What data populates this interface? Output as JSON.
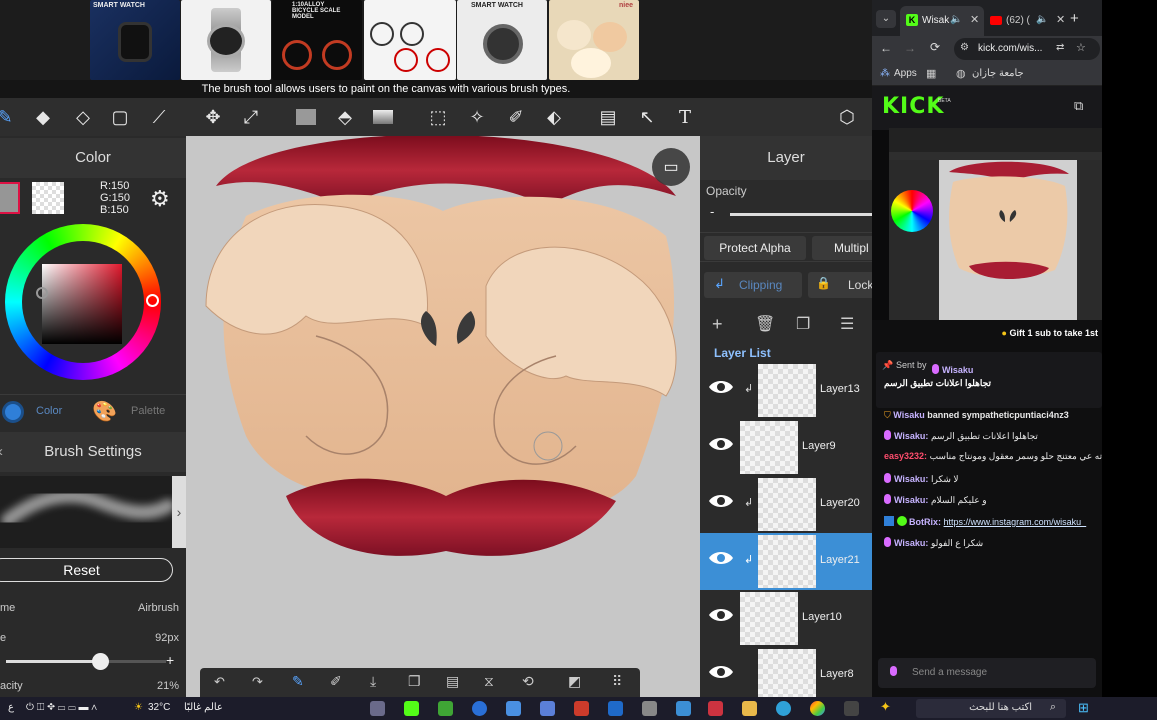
{
  "app": {
    "tooltip": "The brush tool allows users to paint on the canvas with various brush types.",
    "ads": [
      {
        "label": "SMART WATCH"
      },
      {
        "label": ""
      },
      {
        "label": "1:10ALLOY BICYCLE SCALE MODEL"
      },
      {
        "label": ""
      },
      {
        "label": "SMART WATCH"
      },
      {
        "label": "niee"
      }
    ],
    "toolbar_text_tool": "T",
    "color_panel": {
      "title": "Color",
      "r": "R:150",
      "g": "G:150",
      "b": "B:150",
      "tab_color": "Color",
      "tab_palette": "Palette"
    },
    "brush_panel": {
      "title": "Brush Settings",
      "reset_label": "Reset",
      "name_label": "me",
      "name_value": "Airbrush",
      "size_label": "e",
      "size_value": "92px",
      "size_slider_fraction": 0.59,
      "opacity_label": "acity",
      "opacity_value": "21%",
      "plus": "+",
      "minus": "-"
    },
    "layer_panel": {
      "title": "Layer",
      "opacity_label": "Opacity",
      "minus": "-",
      "protect_alpha": "Protect Alpha",
      "multiply": "Multipl",
      "clipping": "Clipping",
      "lock": "Lock",
      "list_title": "Layer List",
      "layers": [
        {
          "name": "Layer13",
          "selected": false
        },
        {
          "name": "Layer9",
          "selected": false
        },
        {
          "name": "Layer20",
          "selected": false
        },
        {
          "name": "Layer21",
          "selected": true
        },
        {
          "name": "Layer10",
          "selected": false
        },
        {
          "name": "Layer8",
          "selected": false
        }
      ]
    }
  },
  "browser": {
    "tabs": [
      {
        "label": "Wisak"
      },
      {
        "label": "(62) ("
      }
    ],
    "address": "kick.com/wis...",
    "bookmarks": {
      "apps": "Apps",
      "folder": "جامعة جازان"
    },
    "kick_logo": "KICK",
    "kick_beta": "BETA",
    "gift_banner": "Gift 1 sub to take 1st",
    "pinned": {
      "sent_by_label": "Sent by",
      "user": "Wisaku",
      "text": "تجاهلوا اعلانات تطبيق الرسم"
    },
    "chat": [
      {
        "user": "Wisaku",
        "text": "banned sympatheticpuntiaci4nz3",
        "kind": "mod"
      },
      {
        "user": "Wisaku:",
        "text": "تجاهلوا اعلانات تطبيق الرسم",
        "kind": "msg"
      },
      {
        "user": "easy3232:",
        "text": "آه وبركاته عي معتنج حلو وسمر معقول ومونتاج مناسب",
        "kind": "red"
      },
      {
        "user": "Wisaku:",
        "text": "لا شكرا",
        "kind": "msg"
      },
      {
        "user": "Wisaku:",
        "text": "و عليكم السلام",
        "kind": "msg"
      },
      {
        "user": "BotRix:",
        "text": "https://www.instagram.com/wisaku_",
        "kind": "bot"
      },
      {
        "user": "Wisaku:",
        "text": "شكرا ع الفولو",
        "kind": "msg"
      }
    ],
    "send_placeholder": "Send a message"
  },
  "taskbar": {
    "search_placeholder": "اكتب هنا للبحث",
    "weather_temp": "32°C",
    "weather_text": "عالم غالبًا",
    "lang": "ع"
  }
}
